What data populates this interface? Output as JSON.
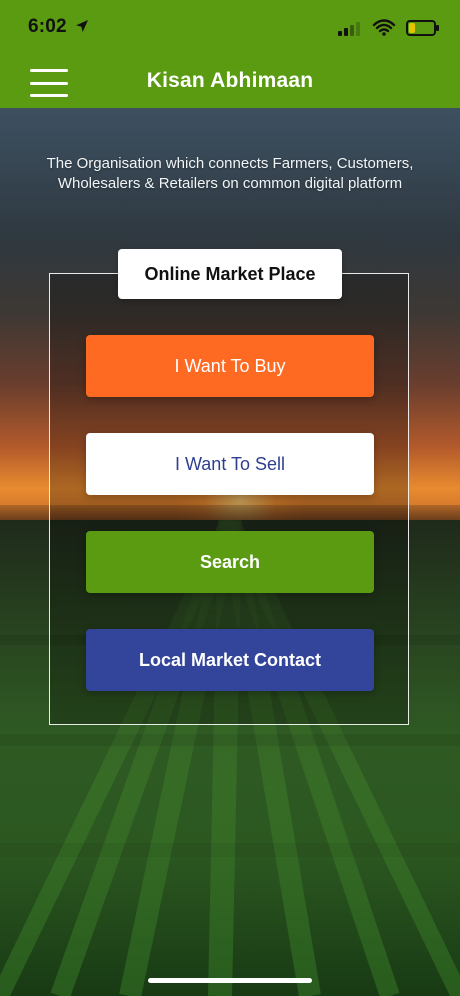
{
  "status_bar": {
    "time": "6:02",
    "icons": {
      "location": "location-arrow-icon",
      "signal": "cellular-signal-icon",
      "wifi": "wifi-icon",
      "battery": "battery-low-icon"
    }
  },
  "app_bar": {
    "title": "Kisan Abhimaan",
    "menu_icon": "hamburger-menu-icon"
  },
  "intro": {
    "text": "The Organisation which connects Farmers, Customers, Wholesalers & Retailers on common digital platform"
  },
  "market": {
    "title": "Online Market Place",
    "buttons": [
      {
        "label": "I Want To Buy"
      },
      {
        "label": "I Want To Sell"
      },
      {
        "label": "Search"
      },
      {
        "label": "Local Market Contact"
      }
    ]
  },
  "colors": {
    "brand_green": "#5a9b12",
    "buy_orange": "#ff6a23",
    "sell_text_blue": "#2f3f8f",
    "local_blue": "#33449b"
  }
}
